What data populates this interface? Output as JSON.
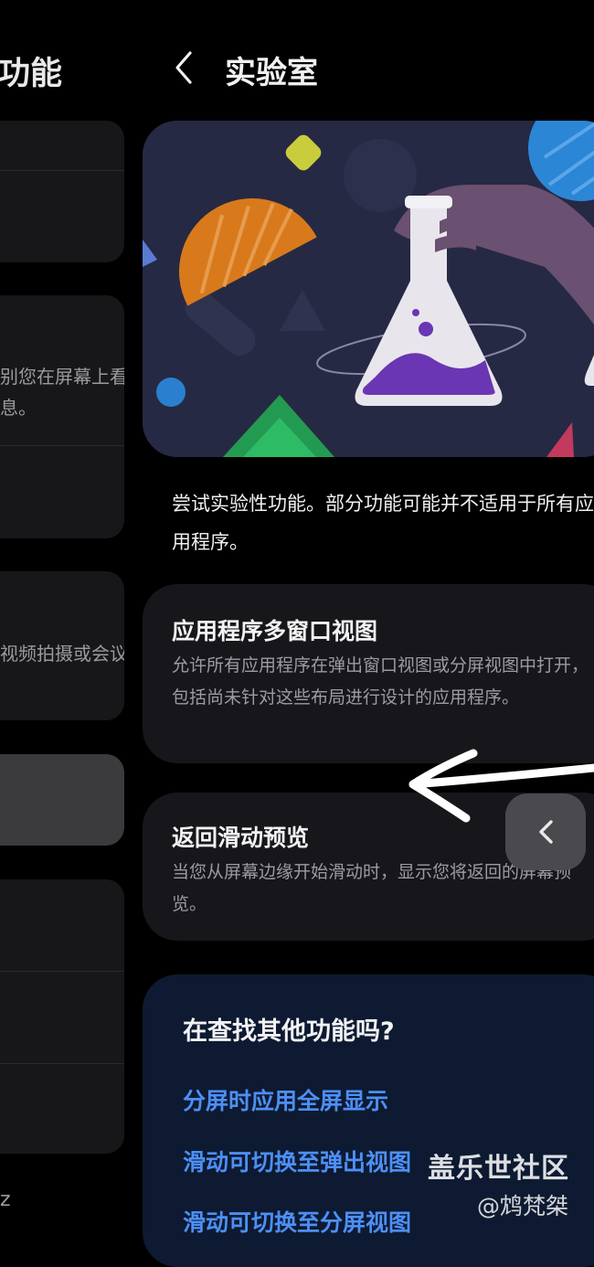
{
  "left_page": {
    "title_fragment": "功能",
    "item_text_1_line1": "别您在屏幕上看",
    "item_text_1_line2": "息。",
    "item_text_2": "视频拍摄或会议",
    "bottom_fragment": "z"
  },
  "header": {
    "back_icon": "chevron-left-icon",
    "title": "实验室"
  },
  "hero": {
    "illustration": "lab-flask-illustration"
  },
  "description": "尝试实验性功能。部分功能可能并不适用于所有应用程序。",
  "features": [
    {
      "title": "应用程序多窗口视图",
      "description": "允许所有应用程序在弹出窗口视图或分屏视图中打开，包括尚未针对这些布局进行设计的应用程序。"
    },
    {
      "title": "返回滑动预览",
      "description": "当您从屏幕边缘开始滑动时，显示您将返回的屏幕预览。"
    }
  ],
  "search_section": {
    "title": "在查找其他功能吗?",
    "links": [
      "分屏时应用全屏显示",
      "滑动可切换至弹出视图",
      "滑动可切换至分屏视图"
    ]
  },
  "edge_back_icon": "chevron-left-icon",
  "watermark": {
    "line1": "盖乐世社区",
    "line2": "@鸩梵桀"
  },
  "colors": {
    "background": "#000000",
    "card": "#17171b",
    "link": "#4d8ff5",
    "search_card": "#0d1a31"
  }
}
